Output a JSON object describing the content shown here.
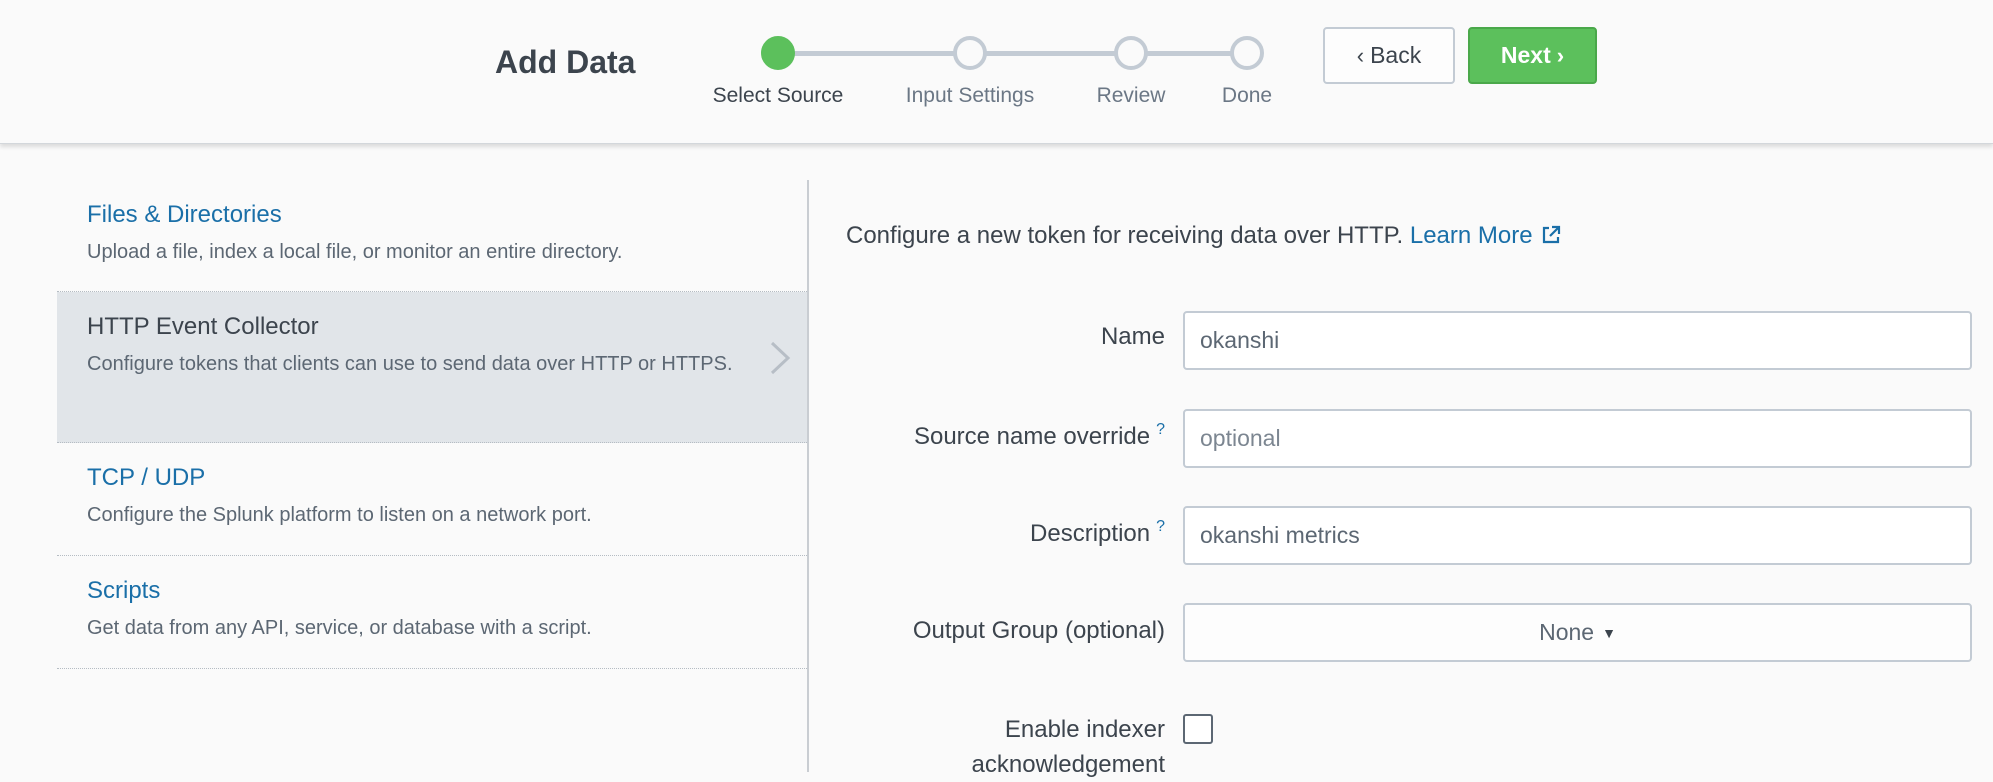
{
  "header": {
    "title": "Add Data",
    "steps": [
      {
        "label": "Select Source",
        "active": true
      },
      {
        "label": "Input Settings",
        "active": false
      },
      {
        "label": "Review",
        "active": false
      },
      {
        "label": "Done",
        "active": false
      }
    ],
    "back_label": "Back",
    "next_label": "Next"
  },
  "sources": [
    {
      "title": "Files & Directories",
      "description": "Upload a file, index a local file, or monitor an entire directory.",
      "selected": false
    },
    {
      "title": "HTTP Event Collector",
      "description": "Configure tokens that clients can use to send data over HTTP or HTTPS.",
      "selected": true
    },
    {
      "title": "TCP / UDP",
      "description": "Configure the Splunk platform to listen on a network port.",
      "selected": false
    },
    {
      "title": "Scripts",
      "description": "Get data from any API, service, or database with a script.",
      "selected": false
    }
  ],
  "form": {
    "intro_text": "Configure a new token for receiving data over HTTP.",
    "learn_more": "Learn More",
    "help_mark": "?",
    "name": {
      "label": "Name",
      "value": "okanshi"
    },
    "source_name_override": {
      "label": "Source name override",
      "value": "",
      "placeholder": "optional"
    },
    "description": {
      "label": "Description",
      "value": "okanshi metrics"
    },
    "output_group": {
      "label": "Output Group (optional)",
      "value": "None"
    },
    "indexer_ack": {
      "label_line1": "Enable indexer",
      "label_line2": "acknowledgement",
      "checked": false
    }
  },
  "colors": {
    "accent_green": "#5cc05c",
    "link_blue": "#1a6fa8",
    "selected_bg": "#e1e5e9"
  }
}
